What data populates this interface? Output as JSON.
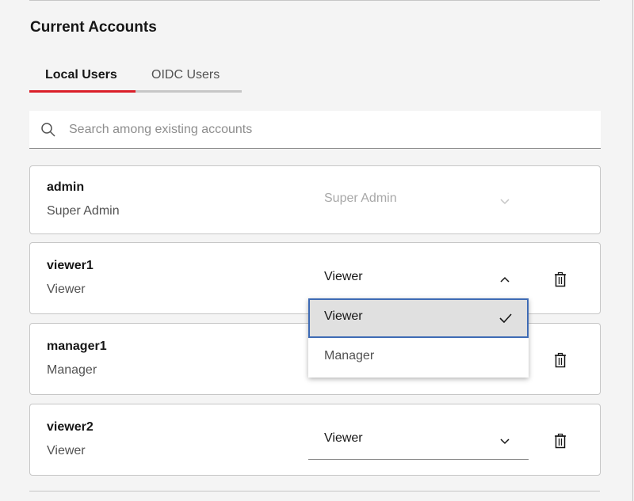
{
  "section": {
    "title": "Current Accounts"
  },
  "tabs": [
    {
      "label": "Local Users",
      "active": true
    },
    {
      "label": "OIDC Users",
      "active": false
    }
  ],
  "search": {
    "placeholder": "Search among existing accounts",
    "value": "",
    "icon": "search-icon"
  },
  "accounts": [
    {
      "name": "admin",
      "role": "Super Admin",
      "select_value": "Super Admin",
      "select_disabled": true,
      "deletable": false
    },
    {
      "name": "viewer1",
      "role": "Viewer",
      "select_value": "Viewer",
      "select_open": true,
      "deletable": true
    },
    {
      "name": "manager1",
      "role": "Manager",
      "select_value": "Manager",
      "deletable": true
    },
    {
      "name": "viewer2",
      "role": "Viewer",
      "select_value": "Viewer",
      "deletable": true
    }
  ],
  "dropdown": {
    "options": [
      {
        "label": "Viewer",
        "selected": true
      },
      {
        "label": "Manager",
        "selected": false
      }
    ]
  },
  "colors": {
    "accent": "#da1e28",
    "focus": "#0f62fe",
    "background": "#f4f4f4"
  }
}
